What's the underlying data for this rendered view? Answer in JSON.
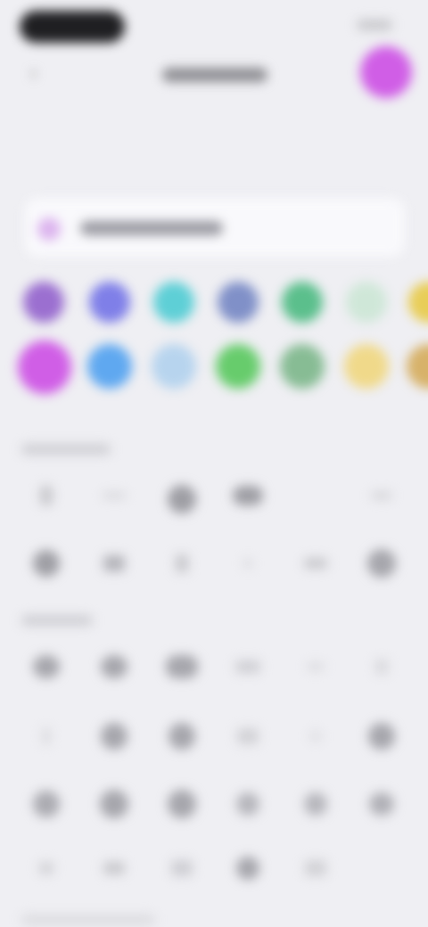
{
  "nav": {
    "back_label": "‹",
    "title": "",
    "preview_color": "#d05ee6"
  },
  "name_field": {
    "placeholder": "",
    "value": ""
  },
  "colors": {
    "row1": [
      "#9b6fd0",
      "#7f7fe8",
      "#5ecfd6",
      "#8090c8",
      "#5bbf8c",
      "#cfe7d8",
      "#e8cd58"
    ],
    "row2": [
      "#d05ee6",
      "#5fa8f0",
      "#b7d4ee",
      "#67cc6c",
      "#87bc94",
      "#f0d98a",
      "#d7b26a"
    ],
    "selected": "#d05ee6"
  },
  "sections": {
    "first": "",
    "second": ""
  },
  "glyphs": {
    "row1": [
      "pencil-icon",
      "line-icon",
      "circle-icon",
      "cloud-icon",
      "blank",
      "line-icon"
    ],
    "row2": [
      "circle-icon",
      "pencil-icon",
      "line-icon",
      "dot-icon",
      "line-icon",
      "circle-icon"
    ],
    "row3": [
      "circle-icon",
      "circle-icon",
      "circle-icon",
      "line-icon",
      "line-icon",
      "line-icon"
    ],
    "row4": [
      "dot-icon",
      "circle-icon",
      "circle-icon",
      "line-icon",
      "dot-icon",
      "circle-icon"
    ],
    "row5": [
      "circle-icon",
      "circle-icon",
      "circle-icon",
      "circle-icon",
      "circle-icon",
      "circle-icon"
    ],
    "row6": [
      "dot-icon",
      "line-icon",
      "line-icon",
      "circle-icon",
      "line-icon"
    ]
  }
}
